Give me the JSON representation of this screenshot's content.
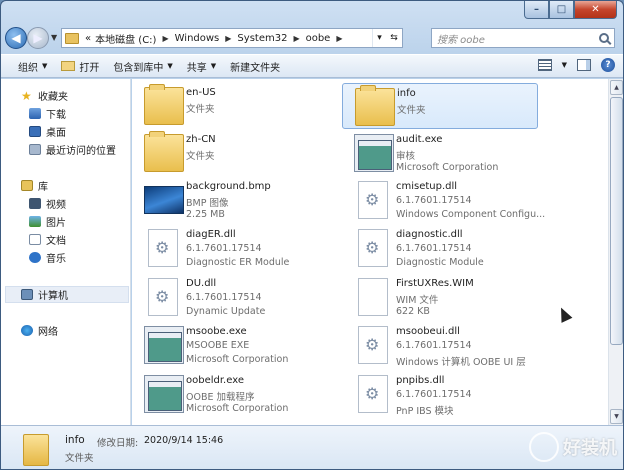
{
  "window_controls": {
    "minimize": "–",
    "maximize": "□",
    "close": "✕"
  },
  "address": {
    "prefix": "«",
    "crumbs": [
      "本地磁盘 (C:)",
      "Windows",
      "System32",
      "oobe"
    ],
    "search_placeholder": "搜索 oobe"
  },
  "toolbar": {
    "organize": "组织",
    "open": "打开",
    "include_library": "包含到库中",
    "share": "共享",
    "new_folder": "新建文件夹"
  },
  "nav": {
    "favorites": "收藏夹",
    "downloads": "下载",
    "desktop": "桌面",
    "recent": "最近访问的位置",
    "libraries": "库",
    "videos": "视频",
    "pictures": "图片",
    "documents": "文档",
    "music": "音乐",
    "computer": "计算机",
    "network": "网络"
  },
  "files": [
    {
      "name": "en-US",
      "line2": "文件夹",
      "line3": "",
      "icon": "folder"
    },
    {
      "name": "info",
      "line2": "文件夹",
      "line3": "",
      "icon": "folder"
    },
    {
      "name": "zh-CN",
      "line2": "文件夹",
      "line3": "",
      "icon": "folder"
    },
    {
      "name": "audit.exe",
      "line2": "审核",
      "line3": "Microsoft Corporation",
      "icon": "exe"
    },
    {
      "name": "background.bmp",
      "line2": "BMP 图像",
      "line3": "2.25 MB",
      "icon": "image"
    },
    {
      "name": "cmisetup.dll",
      "line2": "6.1.7601.17514",
      "line3": "Windows Component Configu...",
      "icon": "dll"
    },
    {
      "name": "diagER.dll",
      "line2": "6.1.7601.17514",
      "line3": "Diagnostic ER Module",
      "icon": "dll"
    },
    {
      "name": "diagnostic.dll",
      "line2": "6.1.7601.17514",
      "line3": "Diagnostic Module",
      "icon": "dll"
    },
    {
      "name": "DU.dll",
      "line2": "6.1.7601.17514",
      "line3": "Dynamic Update",
      "icon": "dll"
    },
    {
      "name": "FirstUXRes.WIM",
      "line2": "WIM 文件",
      "line3": "622 KB",
      "icon": "document"
    },
    {
      "name": "msoobe.exe",
      "line2": "MSOOBE EXE",
      "line3": "Microsoft Corporation",
      "icon": "exe"
    },
    {
      "name": "msoobeui.dll",
      "line2": "6.1.7601.17514",
      "line3": "Windows 计算机 OOBE UI 层",
      "icon": "dll"
    },
    {
      "name": "oobeldr.exe",
      "line2": "OOBE 加载程序",
      "line3": "Microsoft Corporation",
      "icon": "exe"
    },
    {
      "name": "pnpibs.dll",
      "line2": "6.1.7601.17514",
      "line3": "PnP IBS 模块",
      "icon": "dll"
    }
  ],
  "details": {
    "name": "info",
    "date_label": "修改日期:",
    "date": "2020/9/14 15:46",
    "type": "文件夹"
  },
  "watermark": "好装机"
}
